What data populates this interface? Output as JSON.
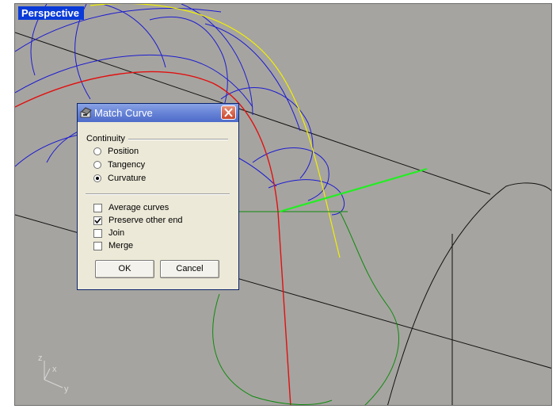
{
  "viewport": {
    "title": "Perspective"
  },
  "axes": {
    "z": "z",
    "x": "x",
    "y": "y"
  },
  "dialog": {
    "title": "Match Curve",
    "continuity_label": "Continuity",
    "options": [
      {
        "label": "Position",
        "selected": false
      },
      {
        "label": "Tangency",
        "selected": false
      },
      {
        "label": "Curvature",
        "selected": true
      }
    ],
    "checkboxes": [
      {
        "label": "Average curves",
        "checked": false
      },
      {
        "label": "Preserve other end",
        "checked": true
      },
      {
        "label": "Join",
        "checked": false
      },
      {
        "label": "Merge",
        "checked": false
      }
    ],
    "ok_label": "OK",
    "cancel_label": "Cancel"
  },
  "colors": {
    "viewport_bg": "#a6a4a0",
    "title_bg": "#0a3bd8",
    "curve_blue": "#1c1cd0",
    "curve_yellow": "#f0f000",
    "curve_red": "#e01010",
    "curve_green": "#0e8a0e",
    "curve_bright_green": "#22ee22"
  }
}
